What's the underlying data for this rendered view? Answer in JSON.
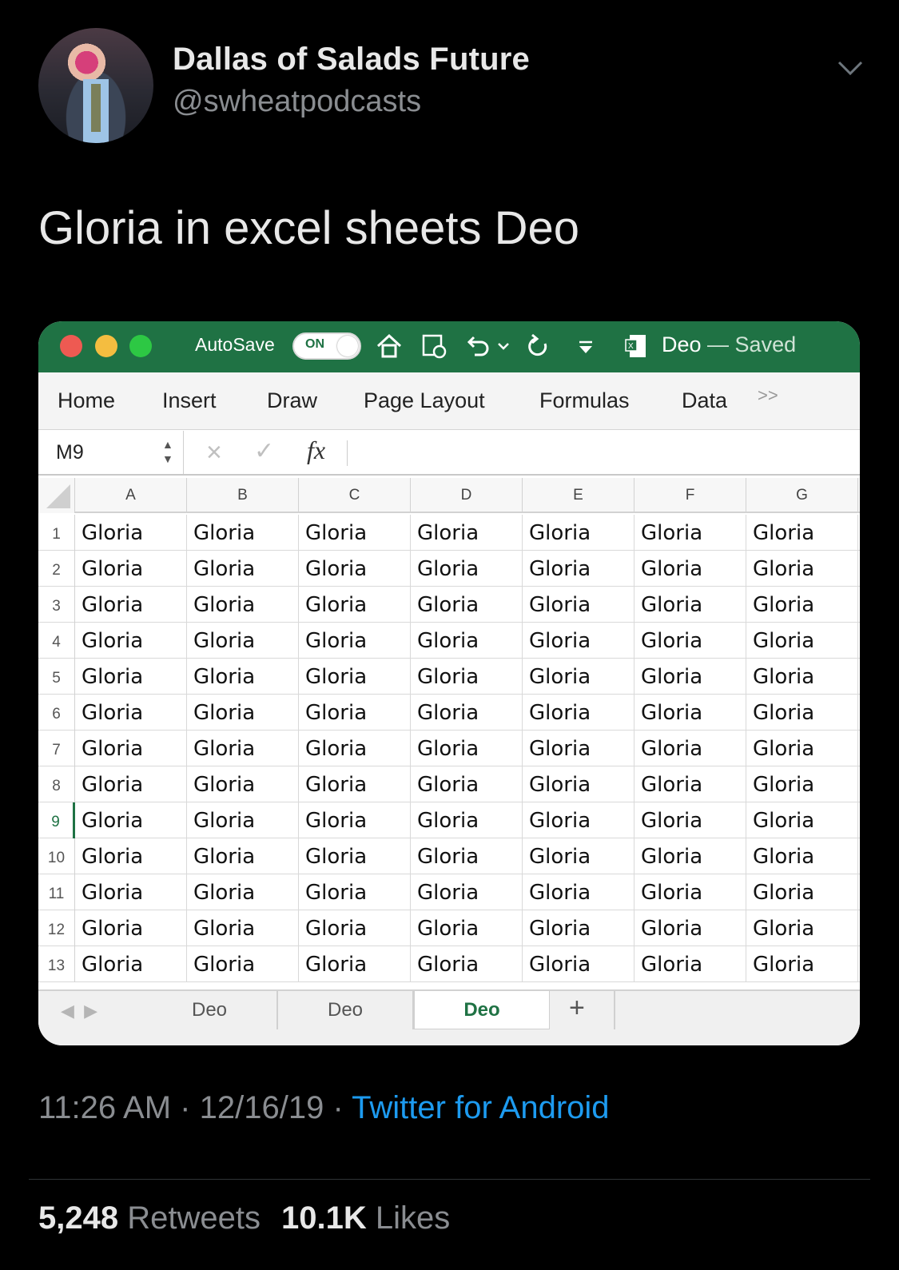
{
  "tweet": {
    "display_name": "Dallas of Salads Future",
    "handle": "@swheatpodcasts",
    "text": "Gloria in excel sheets Deo",
    "time": "11:26 AM",
    "separator": "·",
    "date": "12/16/19",
    "source": "Twitter for Android",
    "retweets_count": "5,248",
    "retweets_label": "Retweets",
    "likes_count": "10.1K",
    "likes_label": "Likes"
  },
  "excel": {
    "autosave_label": "AutoSave",
    "autosave_state": "ON",
    "doc_name": "Deo",
    "doc_status": "— Saved",
    "ribbon_tabs": [
      "Home",
      "Insert",
      "Draw",
      "Page Layout",
      "Formulas",
      "Data"
    ],
    "ribbon_more": ">>",
    "name_box": "M9",
    "fx_label": "fx",
    "columns": [
      "A",
      "B",
      "C",
      "D",
      "E",
      "F",
      "G"
    ],
    "rows": [
      "1",
      "2",
      "3",
      "4",
      "5",
      "6",
      "7",
      "8",
      "9",
      "10",
      "11",
      "12",
      "13"
    ],
    "active_row": "9",
    "cell_value": "Gloria",
    "sheets": [
      "Deo",
      "Deo",
      "Deo"
    ],
    "active_sheet_index": 2,
    "add_sheet": "+"
  },
  "colors": {
    "excel_green": "#1f7244",
    "link_blue": "#1d9bf0",
    "muted_gray": "#8a8d91"
  }
}
